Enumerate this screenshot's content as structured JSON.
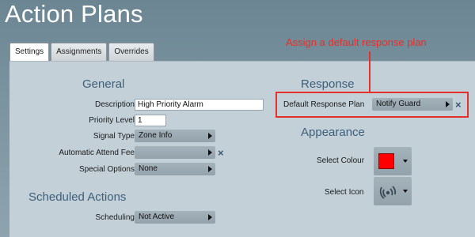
{
  "app": {
    "title": "Action Plans"
  },
  "tabs": [
    {
      "label": "Settings",
      "active": true
    },
    {
      "label": "Assignments",
      "active": false
    },
    {
      "label": "Overrides",
      "active": false
    }
  ],
  "callout": {
    "text": "Assign a default response plan",
    "color": "#e3302a"
  },
  "general": {
    "title": "General",
    "description_label": "Description",
    "description_value": "High Priority Alarm",
    "priority_label": "Priority Level",
    "priority_value": "1",
    "signal_type_label": "Signal Type",
    "signal_type_value": "Zone Info",
    "attend_fee_label": "Automatic Attend Fee",
    "attend_fee_value": "",
    "special_options_label": "Special Options",
    "special_options_value": "None"
  },
  "scheduled": {
    "title": "Scheduled Actions",
    "scheduling_label": "Scheduling",
    "scheduling_value": "Not Active"
  },
  "response": {
    "title": "Response",
    "default_plan_label": "Default Response Plan",
    "default_plan_value": "Notify Guard"
  },
  "appearance": {
    "title": "Appearance",
    "colour_label": "Select Colour",
    "colour_value": "#ff0000",
    "icon_label": "Select Icon",
    "icon_name": "signal-waves-icon"
  },
  "icons": {
    "clear": "×"
  }
}
